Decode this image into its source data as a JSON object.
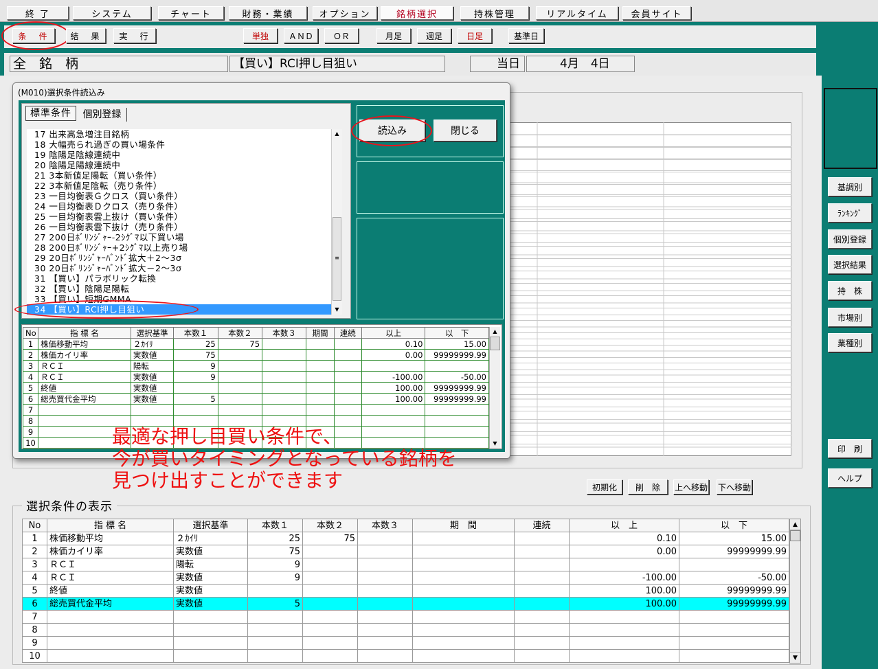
{
  "top_menu": [
    {
      "label": "終 了",
      "active": false
    },
    {
      "label": "システム",
      "active": false
    },
    {
      "label": "チャート",
      "active": false
    },
    {
      "label": "財務・業績",
      "active": false
    },
    {
      "label": "オプション",
      "active": false
    },
    {
      "label": "銘柄選択",
      "active": true
    },
    {
      "label": "持株管理",
      "active": false
    },
    {
      "label": "リアルタイム",
      "active": false
    },
    {
      "label": "会員サイト",
      "active": false
    }
  ],
  "toolbar": {
    "condition": "条　件",
    "result": "結　果",
    "execute": "実　行",
    "single": "単独",
    "and": "ＡＮＤ",
    "or": "ＯＲ",
    "monthly": "月足",
    "weekly": "週足",
    "daily": "日足",
    "base_day": "基準日"
  },
  "info_bar": {
    "universe": "全　銘　柄",
    "condition_name": "【買い】RCI押し目狙い",
    "day_label": "当日",
    "date": "4月　4日"
  },
  "dialog": {
    "title": "(M010)選択条件読込み",
    "tabs": [
      "標準条件",
      "個別登録"
    ],
    "load_button": "読込み",
    "close_button": "閉じる",
    "list": [
      {
        "no": "17",
        "text": "出来高急増注目銘柄",
        "selected": false
      },
      {
        "no": "18",
        "text": "大幅売られ過ぎの買い場条件",
        "selected": false
      },
      {
        "no": "19",
        "text": "陰陽足陰線連続中",
        "selected": false
      },
      {
        "no": "20",
        "text": "陰陽足陽線連続中",
        "selected": false
      },
      {
        "no": "21",
        "text": "3本新値足陽転（買い条件）",
        "selected": false
      },
      {
        "no": "22",
        "text": "3本新値足陰転（売り条件）",
        "selected": false
      },
      {
        "no": "23",
        "text": "一目均衡表Ｇクロス（買い条件）",
        "selected": false
      },
      {
        "no": "24",
        "text": "一目均衡表Ｄクロス（売り条件）",
        "selected": false
      },
      {
        "no": "25",
        "text": "一目均衡表雲上抜け（買い条件）",
        "selected": false
      },
      {
        "no": "26",
        "text": "一目均衡表雲下抜け（売り条件）",
        "selected": false
      },
      {
        "no": "27",
        "text": "200日ﾎﾞﾘﾝｼﾞｬｰ-2ｼｸﾞﾏ以下買い場",
        "selected": false
      },
      {
        "no": "28",
        "text": "200日ﾎﾞﾘﾝｼﾞｬｰ+2ｼｸﾞﾏ以上売り場",
        "selected": false
      },
      {
        "no": "29",
        "text": "20日ﾎﾞﾘﾝｼﾞｬｰﾊﾞﾝﾄﾞ拡大＋2～3σ",
        "selected": false
      },
      {
        "no": "30",
        "text": "20日ﾎﾞﾘﾝｼﾞｬｰﾊﾞﾝﾄﾞ拡大－2～3σ",
        "selected": false
      },
      {
        "no": "31",
        "text": "【買い】パラボリック転換",
        "selected": false
      },
      {
        "no": "32",
        "text": "【買い】陰陽足陽転",
        "selected": false
      },
      {
        "no": "33",
        "text": "【買い】短期GMMA",
        "selected": false
      },
      {
        "no": "34",
        "text": "【買い】RCI押し目狙い",
        "selected": true
      }
    ],
    "table_headers": [
      "No",
      "指 標 名",
      "選択基準",
      "本数１",
      "本数２",
      "本数３",
      "期間",
      "連続",
      "以上",
      "以　下"
    ],
    "rows": [
      [
        "1",
        "株価移動平均",
        "２ｶｲﾘ",
        "25",
        "75",
        "",
        "",
        "",
        "0.10",
        "15.00"
      ],
      [
        "2",
        "株価カイリ率",
        "実数値",
        "75",
        "",
        "",
        "",
        "",
        "0.00",
        "99999999.99"
      ],
      [
        "3",
        "ＲＣＩ",
        "陽転",
        "9",
        "",
        "",
        "",
        "",
        "",
        ""
      ],
      [
        "4",
        "ＲＣＩ",
        "実数値",
        "9",
        "",
        "",
        "",
        "",
        "-100.00",
        "-50.00"
      ],
      [
        "5",
        "終値",
        "実数値",
        "",
        "",
        "",
        "",
        "",
        "100.00",
        "99999999.99"
      ],
      [
        "6",
        "総売買代金平均",
        "実数値",
        "5",
        "",
        "",
        "",
        "",
        "100.00",
        "99999999.99"
      ],
      [
        "7",
        "",
        "",
        "",
        "",
        "",
        "",
        "",
        "",
        ""
      ],
      [
        "8",
        "",
        "",
        "",
        "",
        "",
        "",
        "",
        "",
        ""
      ],
      [
        "9",
        "",
        "",
        "",
        "",
        "",
        "",
        "",
        "",
        ""
      ],
      [
        "10",
        "",
        "",
        "",
        "",
        "",
        "",
        "",
        "",
        ""
      ]
    ]
  },
  "annotation": [
    "最適な押し目買い条件で、",
    "今が買いタイミングとなっている銘柄を",
    "見つけ出すことができます"
  ],
  "side_buttons": [
    "基調別",
    "ﾗﾝｷﾝｸﾞ",
    "個別登録",
    "選択結果",
    "持　株",
    "市場別",
    "業種別"
  ],
  "side_bottom": [
    "印　刷",
    "ヘルプ"
  ],
  "edit_buttons": [
    "初期化",
    "削　除",
    "上へ移動",
    "下へ移動"
  ],
  "selection_title": "選択条件の表示",
  "main_table": {
    "headers": [
      "No",
      "指 標 名",
      "選択基準",
      "本数１",
      "本数２",
      "本数３",
      "期　間",
      "連続",
      "以　上",
      "以　下"
    ],
    "rows": [
      [
        "1",
        "株価移動平均",
        "２ｶｲﾘ",
        "25",
        "75",
        "",
        "",
        "",
        "0.10",
        "15.00"
      ],
      [
        "2",
        "株価カイリ率",
        "実数値",
        "75",
        "",
        "",
        "",
        "",
        "0.00",
        "99999999.99"
      ],
      [
        "3",
        "ＲＣＩ",
        "陽転",
        "9",
        "",
        "",
        "",
        "",
        "",
        ""
      ],
      [
        "4",
        "ＲＣＩ",
        "実数値",
        "9",
        "",
        "",
        "",
        "",
        "-100.00",
        "-50.00"
      ],
      [
        "5",
        "終値",
        "実数値",
        "",
        "",
        "",
        "",
        "",
        "100.00",
        "99999999.99"
      ],
      [
        "6",
        "総売買代金平均",
        "実数値",
        "5",
        "",
        "",
        "",
        "",
        "100.00",
        "99999999.99"
      ],
      [
        "7",
        "",
        "",
        "",
        "",
        "",
        "",
        "",
        "",
        ""
      ],
      [
        "8",
        "",
        "",
        "",
        "",
        "",
        "",
        "",
        "",
        ""
      ],
      [
        "9",
        "",
        "",
        "",
        "",
        "",
        "",
        "",
        "",
        ""
      ],
      [
        "10",
        "",
        "",
        "",
        "",
        "",
        "",
        "",
        "",
        ""
      ]
    ],
    "selected_row": "6"
  },
  "colors": {
    "teal": "#0b7d73",
    "highlight": "#00ffff",
    "annotation": "#ee1111",
    "list_selection": "#3399ff"
  }
}
